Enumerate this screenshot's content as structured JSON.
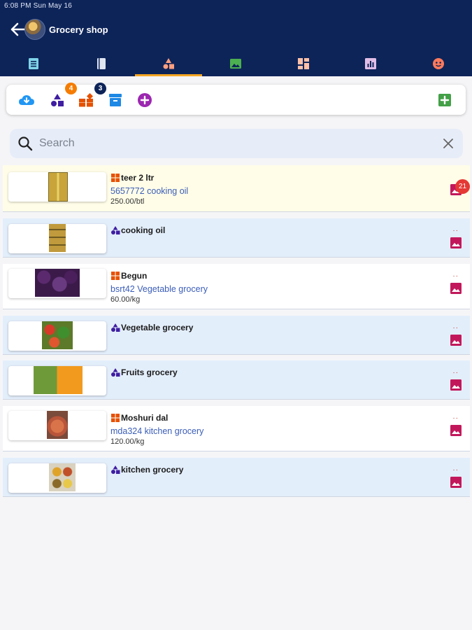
{
  "status_bar": {
    "text": "6:08 PM   Sun May 16"
  },
  "header": {
    "title": "Grocery shop"
  },
  "colors": {
    "header_bg": "#0d2459",
    "tab_indicator": "#f5a623",
    "category_row_bg": "#e3eefb",
    "selected_row_bg": "#fffde8",
    "link_text": "#3a5db7"
  },
  "tabs": [
    {
      "icon": "list-icon",
      "color": "#7fd3e8"
    },
    {
      "icon": "book-icon",
      "color": "#dfe6f2"
    },
    {
      "icon": "shapes-icon",
      "color": "#ff9f80",
      "active": true
    },
    {
      "icon": "image-icon",
      "color": "#4caf50"
    },
    {
      "icon": "dashboard-icon",
      "color": "#ffc0a8"
    },
    {
      "icon": "chart-icon",
      "color": "#e1bee7"
    },
    {
      "icon": "face-icon",
      "color": "#ff7a5c"
    }
  ],
  "toolbar": {
    "category_badge": "4",
    "product_badge": "3"
  },
  "search": {
    "placeholder": "Search",
    "value": ""
  },
  "items": [
    {
      "type": "product",
      "name": "teer 2 ltr",
      "subtitle": "5657772 cooking oil",
      "price": "250.00/btl",
      "badge": "21"
    },
    {
      "type": "category",
      "name": "cooking oil"
    },
    {
      "type": "product",
      "name": "Begun",
      "subtitle": "bsrt42 Vegetable grocery",
      "price": "60.00/kg"
    },
    {
      "type": "category",
      "name": "Vegetable grocery"
    },
    {
      "type": "category",
      "name": "Fruits grocery"
    },
    {
      "type": "product",
      "name": "Moshuri dal",
      "subtitle": "mda324 kitchen grocery",
      "price": "120.00/kg"
    },
    {
      "type": "category",
      "name": "kitchen grocery"
    }
  ]
}
